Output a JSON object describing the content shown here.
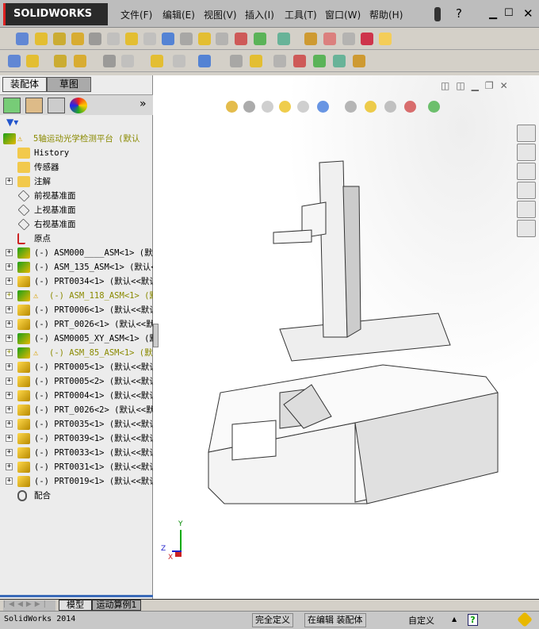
{
  "app": {
    "logo": "SOLIDWORKS",
    "menus": [
      "文件(F)",
      "编辑(E)",
      "视图(V)",
      "插入(I)",
      "工具(T)",
      "窗口(W)",
      "帮助(H)"
    ],
    "help": "?"
  },
  "panel": {
    "tabs": [
      "装配体",
      "草图"
    ],
    "chevron": "»",
    "tree": [
      {
        "label": "5轴运动光学检测平台  (默认",
        "icon": "assembly",
        "warn": true,
        "root": true
      },
      {
        "label": "History",
        "icon": "history-folder"
      },
      {
        "label": "传感器",
        "icon": "sensor-folder"
      },
      {
        "label": "注解",
        "icon": "annotation-folder",
        "expand": true
      },
      {
        "label": "前视基准面",
        "icon": "plane"
      },
      {
        "label": "上视基准面",
        "icon": "plane"
      },
      {
        "label": "右视基准面",
        "icon": "plane"
      },
      {
        "label": "原点",
        "icon": "origin"
      },
      {
        "label": "(-) ASM000____ASM<1> (默认",
        "icon": "assembly",
        "expand": true
      },
      {
        "label": "(-) ASM_135_ASM<1> (默认<",
        "icon": "assembly",
        "expand": true
      },
      {
        "label": "(-) PRT0034<1> (默认<<默认",
        "icon": "part",
        "expand": true
      },
      {
        "label": "(-) ASM_118_ASM<1> (默认",
        "icon": "assembly",
        "expand": true,
        "warn": true
      },
      {
        "label": "(-) PRT0006<1> (默认<<默认",
        "icon": "part",
        "expand": true
      },
      {
        "label": "(-) PRT_0026<1> (默认<<默",
        "icon": "part",
        "expand": true
      },
      {
        "label": "(-) ASM0005_XY_ASM<1> (默",
        "icon": "assembly",
        "expand": true
      },
      {
        "label": "(-) ASM_85_ASM<1> (默认",
        "icon": "assembly",
        "expand": true,
        "warn": true
      },
      {
        "label": "(-) PRT0005<1> (默认<<默认",
        "icon": "part",
        "expand": true
      },
      {
        "label": "(-) PRT0005<2> (默认<<默认",
        "icon": "part",
        "expand": true
      },
      {
        "label": "(-) PRT0004<1> (默认<<默认",
        "icon": "part",
        "expand": true
      },
      {
        "label": "(-) PRT_0026<2> (默认<<默",
        "icon": "part",
        "expand": true
      },
      {
        "label": "(-) PRT0035<1> (默认<<默认",
        "icon": "part",
        "expand": true
      },
      {
        "label": "(-) PRT0039<1> (默认<<默认",
        "icon": "part",
        "expand": true
      },
      {
        "label": "(-) PRT0033<1> (默认<<默认",
        "icon": "part",
        "expand": true
      },
      {
        "label": "(-) PRT0031<1> (默认<<默认",
        "icon": "part",
        "expand": true
      },
      {
        "label": "(-) PRT0019<1> (默认<<默认",
        "icon": "part",
        "expand": true
      },
      {
        "label": "配合",
        "icon": "mates"
      }
    ]
  },
  "bottom_tabs": [
    "模型",
    "运动算例1"
  ],
  "status": {
    "app": "SolidWorks 2014",
    "defined": "完全定义",
    "editing": "在编辑 装配体",
    "custom": "自定义",
    "help": "?"
  },
  "triad": {
    "x": "X",
    "y": "Y",
    "z": "Z"
  },
  "colors": {
    "warn_text": "#8a8a00",
    "assembly": "#1aa01a",
    "part": "#e8b800"
  }
}
